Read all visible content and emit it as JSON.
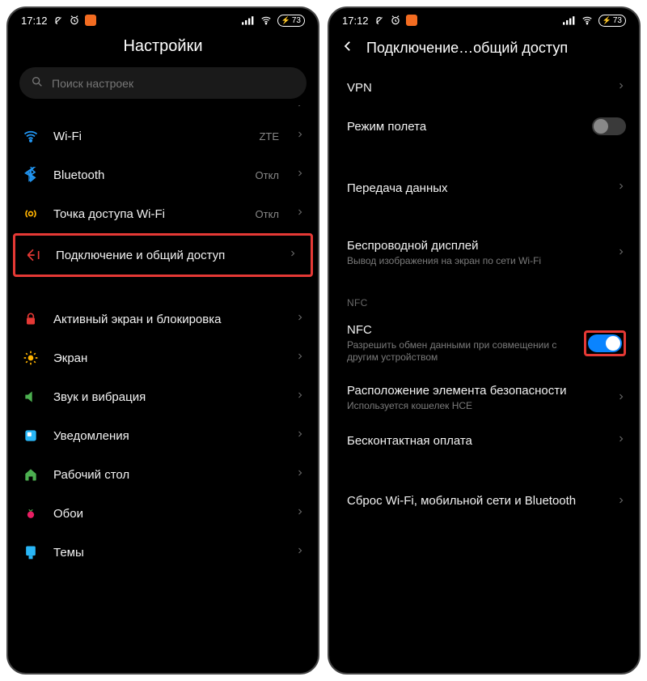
{
  "status": {
    "time": "17:12",
    "battery": "73"
  },
  "left": {
    "title": "Настройки",
    "search_placeholder": "Поиск настроек",
    "items": {
      "wifi": {
        "label": "Wi-Fi",
        "value": "ZTE"
      },
      "bluetooth": {
        "label": "Bluetooth",
        "value": "Откл"
      },
      "hotspot": {
        "label": "Точка доступа Wi-Fi",
        "value": "Откл"
      },
      "connection": {
        "label": "Подключение и общий доступ"
      },
      "lockscreen": {
        "label": "Активный экран и блокировка"
      },
      "display": {
        "label": "Экран"
      },
      "sound": {
        "label": "Звук и вибрация"
      },
      "notifications": {
        "label": "Уведомления"
      },
      "desktop": {
        "label": "Рабочий стол"
      },
      "wallpaper": {
        "label": "Обои"
      },
      "themes": {
        "label": "Темы"
      }
    }
  },
  "right": {
    "title": "Подключение…общий доступ",
    "items": {
      "vpn": {
        "label": "VPN"
      },
      "airplane": {
        "label": "Режим полета"
      },
      "data": {
        "label": "Передача данных"
      },
      "cast": {
        "label": "Беспроводной дисплей",
        "subtitle": "Вывод изображения на экран по сети Wi-Fi"
      },
      "nfc_section": "NFC",
      "nfc": {
        "label": "NFC",
        "subtitle": "Разрешить обмен данными при совмещении с другим устройством"
      },
      "secure_element": {
        "label": "Расположение элемента безопасности",
        "subtitle": "Используется кошелек HCE"
      },
      "contactless": {
        "label": "Бесконтактная оплата"
      },
      "reset": {
        "label": "Сброс Wi-Fi, мобильной сети и Bluetooth"
      }
    }
  }
}
